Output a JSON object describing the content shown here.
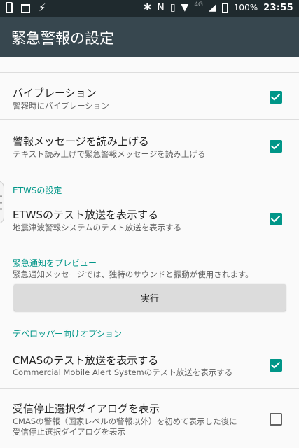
{
  "status_bar": {
    "time": "23:55",
    "battery": "100%",
    "network": "4G",
    "left_icons": [
      "phone-icon",
      "calendar-icon",
      "bolt-icon"
    ],
    "right_icons": [
      "bluetooth-icon",
      "nfc-icon",
      "vibrate-icon",
      "wifi-icon",
      "signal-icon",
      "battery-icon"
    ]
  },
  "app_bar": {
    "title": "緊急警報の設定"
  },
  "settings": {
    "vibration": {
      "title": "バイブレーション",
      "summary": "警報時にバイブレーション",
      "checked": true
    },
    "speak": {
      "title": "警報メッセージを読み上げる",
      "summary": "テキスト読み上げで緊急警報メッセージを読み上げる",
      "checked": true
    },
    "etws_category": "ETWSの設定",
    "etws_test": {
      "title": "ETWSのテスト放送を表示する",
      "summary": "地震津波警報システムのテスト放送を表示する",
      "checked": true
    },
    "preview_category": "緊急通知をプレビュー",
    "preview_summary": "緊急通知メッセージでは、独特のサウンドと振動が使用されます。",
    "run_button": "実行",
    "dev_category": "デベロッパー向けオプション",
    "cmas_test": {
      "title": "CMASのテスト放送を表示する",
      "summary": "Commercial Mobile Alert Systemのテスト放送を表示する",
      "checked": true
    },
    "opt_out": {
      "title": "受信停止選択ダイアログを表示",
      "summary_line1": "CMASの警報（国家レベルの警報以外）を初めて表示した後に",
      "summary_line2": "受信停止選択ダイアログを表示",
      "checked": false
    }
  },
  "colors": {
    "accent": "#009688",
    "app_bar": "#37474f",
    "status_bar": "#1f2a2e"
  }
}
